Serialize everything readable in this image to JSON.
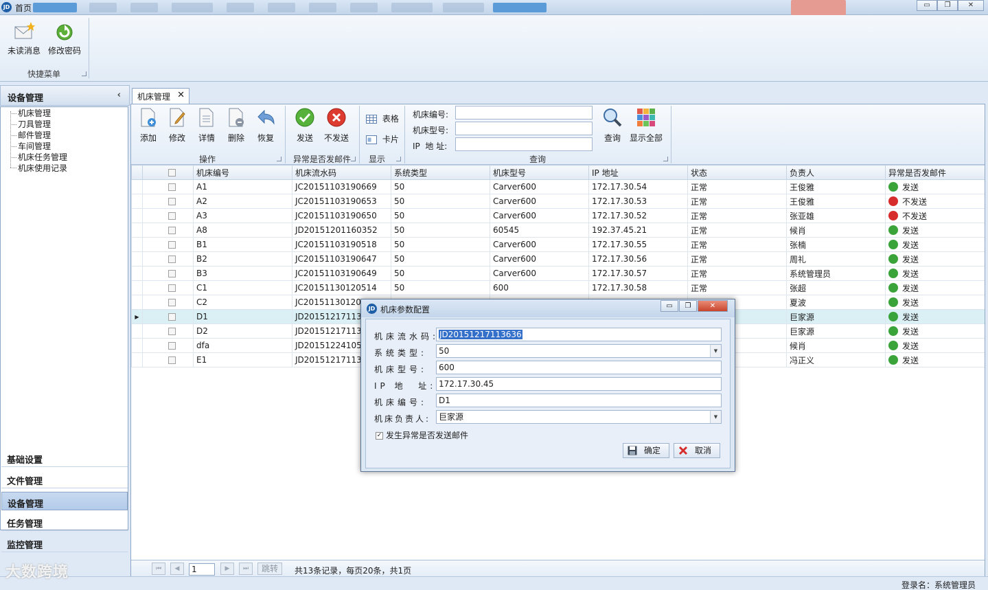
{
  "app": {
    "title": "首页",
    "logo": "JD"
  },
  "window_controls": {
    "minimize": "▭",
    "restore": "❐",
    "close": "✕"
  },
  "ribbon": {
    "buttons": [
      {
        "label": "未读消息",
        "icon": "envelope-star-icon"
      },
      {
        "label": "修改密码",
        "icon": "refresh-icon"
      }
    ],
    "group_label": "快捷菜单"
  },
  "sidebar": {
    "title": "设备管理",
    "collapse": "‹",
    "tree": [
      "机床管理",
      "刀具管理",
      "邮件管理",
      "车间管理",
      "机床任务管理",
      "机床使用记录"
    ],
    "nav": [
      "基础设置",
      "文件管理",
      "设备管理",
      "任务管理",
      "监控管理"
    ]
  },
  "tab": {
    "label": "机床管理",
    "close": "✕"
  },
  "toolbar": {
    "ops": [
      "添加",
      "修改",
      "详情",
      "删除",
      "恢复"
    ],
    "ops_group": "操作",
    "mail": [
      "发送",
      "不发送"
    ],
    "mail_group": "异常是否发邮件",
    "display": [
      "表格",
      "卡片"
    ],
    "display_group": "显示",
    "query_labels": [
      "机床编号:",
      "机床型号:",
      "IP  地 址:"
    ],
    "query_group": "查询",
    "query_btn": "查询",
    "show_all_btn": "显示全部"
  },
  "grid": {
    "columns": [
      "机床编号",
      "机床流水码",
      "系统类型",
      "机床型号",
      "IP 地址",
      "状态",
      "负责人",
      "异常是否发邮件"
    ],
    "rows": [
      [
        "A1",
        "JC20151103190669",
        "50",
        "Carver600",
        "172.17.30.54",
        "正常",
        "王俊雅",
        "发送"
      ],
      [
        "A2",
        "JC20151103190653",
        "50",
        "Carver600",
        "172.17.30.53",
        "正常",
        "王俊雅",
        "不发送"
      ],
      [
        "A3",
        "JC20151103190650",
        "50",
        "Carver600",
        "172.17.30.52",
        "正常",
        "张亚雄",
        "不发送"
      ],
      [
        "A8",
        "JD20151201160352",
        "50",
        "60545",
        "192.37.45.21",
        "正常",
        "候肖",
        "发送"
      ],
      [
        "B1",
        "JC20151103190518",
        "50",
        "Carver600",
        "172.17.30.55",
        "正常",
        "张楠",
        "发送"
      ],
      [
        "B2",
        "JC20151103190647",
        "50",
        "Carver600",
        "172.17.30.56",
        "正常",
        "周礼",
        "发送"
      ],
      [
        "B3",
        "JC20151103190649",
        "50",
        "Carver600",
        "172.17.30.57",
        "正常",
        "系统管理员",
        "发送"
      ],
      [
        "C1",
        "JC20151130120514",
        "50",
        "600",
        "172.17.30.58",
        "正常",
        "张超",
        "发送"
      ],
      [
        "C2",
        "JC201511301205",
        "",
        "",
        "",
        "",
        "夏波",
        "发送"
      ],
      [
        "D1",
        "JD201512171136",
        "",
        "",
        "",
        "",
        "巨家源",
        "发送"
      ],
      [
        "D2",
        "JD201512171137",
        "",
        "",
        "",
        "",
        "巨家源",
        "发送"
      ],
      [
        "dfa",
        "JD201512241054",
        "",
        "",
        "",
        "",
        "候肖",
        "发送"
      ],
      [
        "E1",
        "JD201512171137",
        "",
        "",
        "",
        "",
        "冯正义",
        "发送"
      ]
    ],
    "selected_row": 9
  },
  "pager": {
    "first": "⏮",
    "prev": "◀",
    "next": "▶",
    "last": "⏭",
    "page": "1",
    "jump": "跳转",
    "info": "共13条记录，每页20条，共1页"
  },
  "status": {
    "user": "登录名：系统管理员"
  },
  "watermark": "大数跨境",
  "dialog": {
    "title": "机床参数配置",
    "fields": [
      {
        "label": "机床流水码:",
        "value": "JD20151217113636"
      },
      {
        "label": "系统类型:",
        "value": "50"
      },
      {
        "label": "机床型号:",
        "value": "600"
      },
      {
        "label": "IP 地  址:",
        "value": "172.17.30.45"
      },
      {
        "label": "机床编号:",
        "value": "D1"
      },
      {
        "label": "机床负责人:",
        "value": "巨家源"
      }
    ],
    "checkbox": {
      "label": "发生异常是否发送邮件",
      "checked": true,
      "mark": "✓"
    },
    "ok": "确定",
    "cancel": "取消"
  },
  "colors": {
    "accent": "#1f5fa8",
    "ok": "#3aa33a",
    "no": "#d62c2c",
    "selection": "#daf0f5"
  }
}
